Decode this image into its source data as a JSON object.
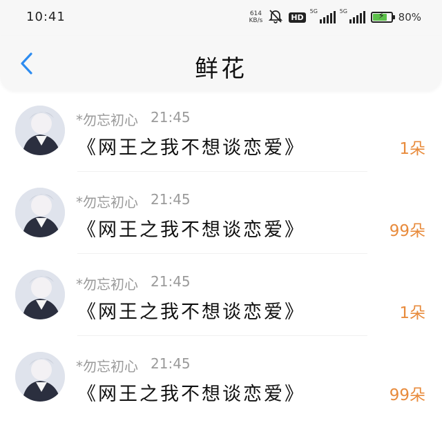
{
  "status": {
    "time": "10:41",
    "net_speed_value": "614",
    "net_speed_unit": "KB/s",
    "hd": "HD",
    "sim1": "5G",
    "sim2": "5G",
    "battery_pct": "80%",
    "battery_level": 0.8,
    "battery_color": "#5cc04a",
    "icons": [
      "mute-bell-icon",
      "signal-icon",
      "battery-icon"
    ]
  },
  "header": {
    "title": "鲜花",
    "back_icon": "chevron-left-icon",
    "accent": "#2d8cf0"
  },
  "list": {
    "accent_count_color": "#e88b3c",
    "items": [
      {
        "user": "*勿忘初心",
        "time": "21:45",
        "book": "《网王之我不想谈恋爱》",
        "count": "1朵"
      },
      {
        "user": "*勿忘初心",
        "time": "21:45",
        "book": "《网王之我不想谈恋爱》",
        "count": "99朵"
      },
      {
        "user": "*勿忘初心",
        "time": "21:45",
        "book": "《网王之我不想谈恋爱》",
        "count": "1朵"
      },
      {
        "user": "*勿忘初心",
        "time": "21:45",
        "book": "《网王之我不想谈恋爱》",
        "count": "99朵"
      }
    ]
  }
}
